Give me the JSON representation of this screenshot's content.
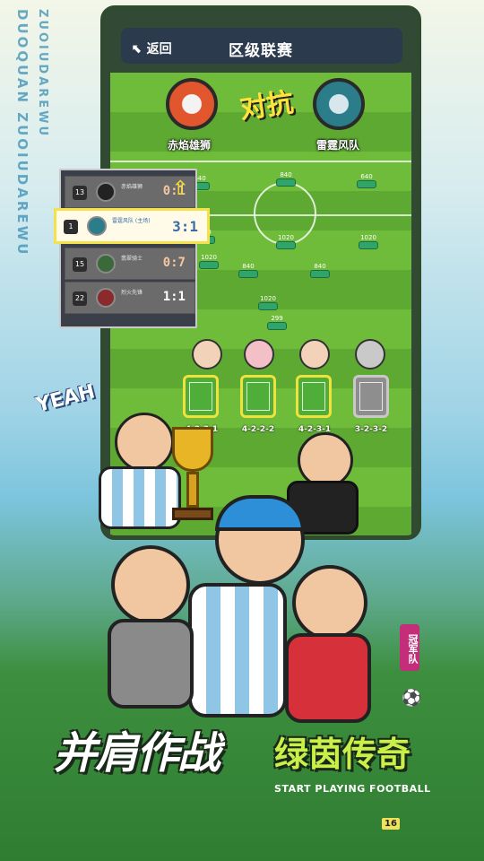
{
  "side_text": {
    "line1": "DUOQUAN ZUOIUDAREWU",
    "line2": ""
  },
  "board": {
    "back_label": "返回",
    "title": "区级联赛"
  },
  "match": {
    "vs_text": "对抗",
    "home": {
      "name": "赤焰雄狮",
      "color": "#e2562e"
    },
    "away": {
      "name": "雷霆风队",
      "color": "#2c7d8a"
    }
  },
  "field_slots": [
    "640",
    "840",
    "640",
    "840",
    "1020",
    "1020",
    "1020",
    "840",
    "840",
    "1020",
    "299"
  ],
  "formations": [
    {
      "label": "4-2-3-1",
      "active": true
    },
    {
      "label": "4-2-2-2",
      "active": true
    },
    {
      "label": "4-2-3-1",
      "active": true
    },
    {
      "label": "3-2-3-2",
      "active": false
    }
  ],
  "ranking": [
    {
      "pos": "13",
      "name": "赤焰雄狮",
      "score": "0:1",
      "highlight": false
    },
    {
      "pos": "1",
      "name": "雷霆风队 (主场)",
      "score": "3:1",
      "highlight": true
    },
    {
      "pos": "15",
      "name": "翡翠骑士",
      "score": "0:7",
      "highlight": false
    },
    {
      "pos": "22",
      "name": "烈火先锋",
      "score": "1:1",
      "highlight": false
    }
  ],
  "yeah_text": "YEAH",
  "slogan": {
    "cn_main": "并肩作战",
    "cn_accent": "绿茵传奇",
    "en": "START PLAYING FOOTBALL"
  },
  "side_tag": "冠军队",
  "corner_badge": "16"
}
